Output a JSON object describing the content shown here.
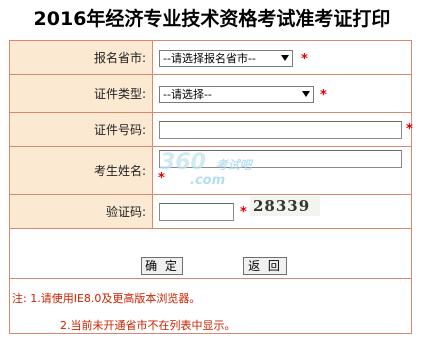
{
  "page": {
    "title": "2016年经济专业技术资格考试准考证打印"
  },
  "form": {
    "province": {
      "label": "报名省市:",
      "selected": "--请选择报名省市--",
      "required_mark": "*"
    },
    "id_type": {
      "label": "证件类型:",
      "selected": "--请选择--",
      "required_mark": "*"
    },
    "id_number": {
      "label": "证件号码:",
      "value": "",
      "required_mark": "*"
    },
    "name": {
      "label": "考生姓名:",
      "value": "",
      "required_mark": "*"
    },
    "captcha": {
      "label": "验证码:",
      "value": "",
      "required_mark": "*",
      "image_text": "28339"
    }
  },
  "buttons": {
    "confirm": "确 定",
    "back": "返 回"
  },
  "notes": {
    "line1": "注: 1.请使用IE8.0及更高版本浏览器。",
    "line2": "2.当前未开通省市不在列表中显示。"
  },
  "watermark": {
    "main": "360",
    "sub": "考试吧",
    "domain": ".com"
  },
  "colors": {
    "label_bg": "#fbe9d2",
    "border": "#d88a6e",
    "required": "#e00000",
    "note_text": "#cc2200"
  }
}
